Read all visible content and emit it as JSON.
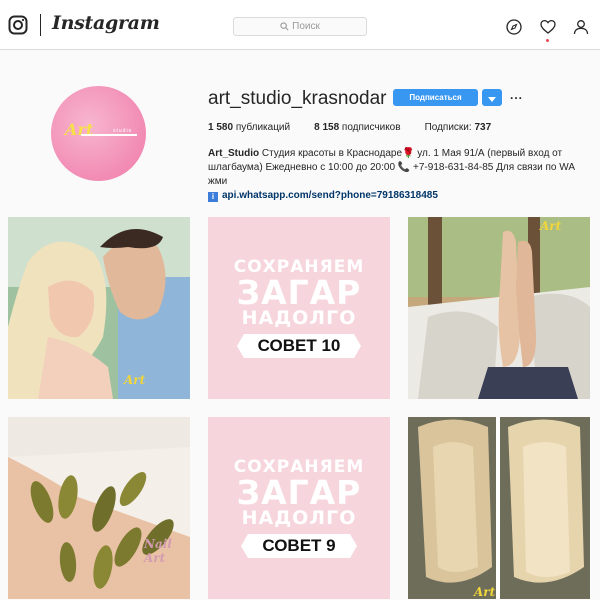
{
  "header": {
    "wordmark": "Instagram",
    "search_placeholder": "Поиск"
  },
  "profile": {
    "username": "art_studio_krasnodar",
    "follow_label": "Подписаться",
    "more_label": "...",
    "avatar_text": "Art",
    "avatar_sub": "studio",
    "stats": {
      "posts_count": "1 580",
      "posts_label": "публикаций",
      "followers_count": "8 158",
      "followers_label": "подписчиков",
      "following_label": "Подписки:",
      "following_count": "737"
    },
    "bio": {
      "name": "Art_Studio",
      "line1": "Студия красоты в Краснодаре🌹 ул. 1 Мая 91/А (первый вход от",
      "line2": "шлагбаума) Ежедневно с 10:00 до 20:00 📞 +7-918-631-84-85 Для связи по WA жми",
      "link": "api.whatsapp.com/send?phone=79186318485"
    }
  },
  "posts": [
    {
      "kind": "photo",
      "watermark": "Art"
    },
    {
      "kind": "text",
      "line1": "СОХРАНЯЕМ",
      "line2": "ЗАГАР",
      "line3": "НАДОЛГО",
      "badge": "СОВЕТ 10"
    },
    {
      "kind": "photo",
      "watermark": "Art"
    },
    {
      "kind": "photo",
      "watermark": "Nail Art"
    },
    {
      "kind": "text",
      "line1": "СОХРАНЯЕМ",
      "line2": "ЗАГАР",
      "line3": "НАДОЛГО",
      "badge": "СОВЕТ 9"
    },
    {
      "kind": "photo",
      "watermark": "Art"
    }
  ],
  "colors": {
    "accent": "#3897f0",
    "notification": "#ed4956",
    "tip_background": "#f6d6dc"
  }
}
